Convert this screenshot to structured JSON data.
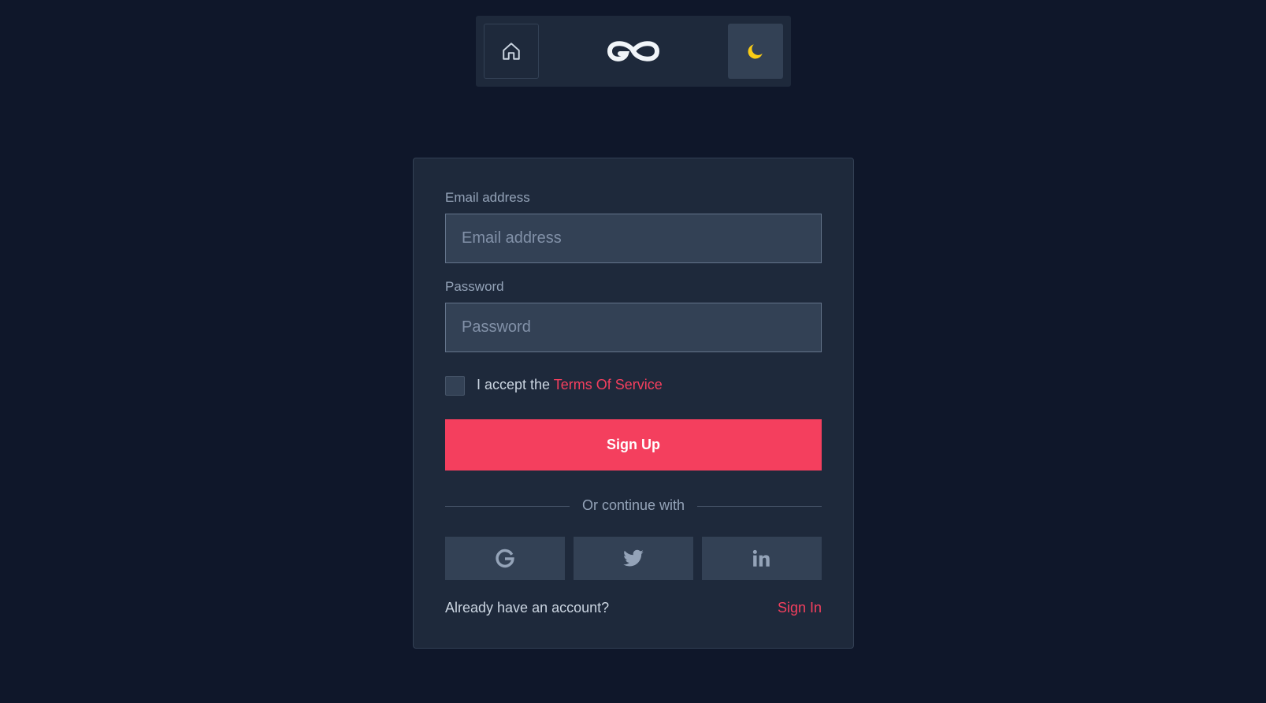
{
  "nav": {
    "home_icon": "home-icon",
    "logo_icon": "infinity-logo",
    "theme_icon": "moon-icon",
    "theme_icon_color": "#facc15"
  },
  "form": {
    "email_label": "Email address",
    "email_placeholder": "Email address",
    "email_value": "",
    "password_label": "Password",
    "password_placeholder": "Password",
    "password_value": "",
    "terms_prefix": "I accept the ",
    "terms_link": "Terms Of Service",
    "terms_checked": false,
    "submit_label": "Sign Up"
  },
  "social": {
    "divider_text": "Or continue with",
    "providers": [
      {
        "name": "Google",
        "icon": "google-icon"
      },
      {
        "name": "Twitter",
        "icon": "twitter-icon"
      },
      {
        "name": "LinkedIn",
        "icon": "linkedin-icon"
      }
    ]
  },
  "footer": {
    "prompt": "Already have an account?",
    "signin_label": "Sign In"
  },
  "colors": {
    "background": "#0f172a",
    "card": "#1e293b",
    "input": "#334155",
    "accent": "#f43f5e",
    "muted_text": "#94a3b8"
  }
}
